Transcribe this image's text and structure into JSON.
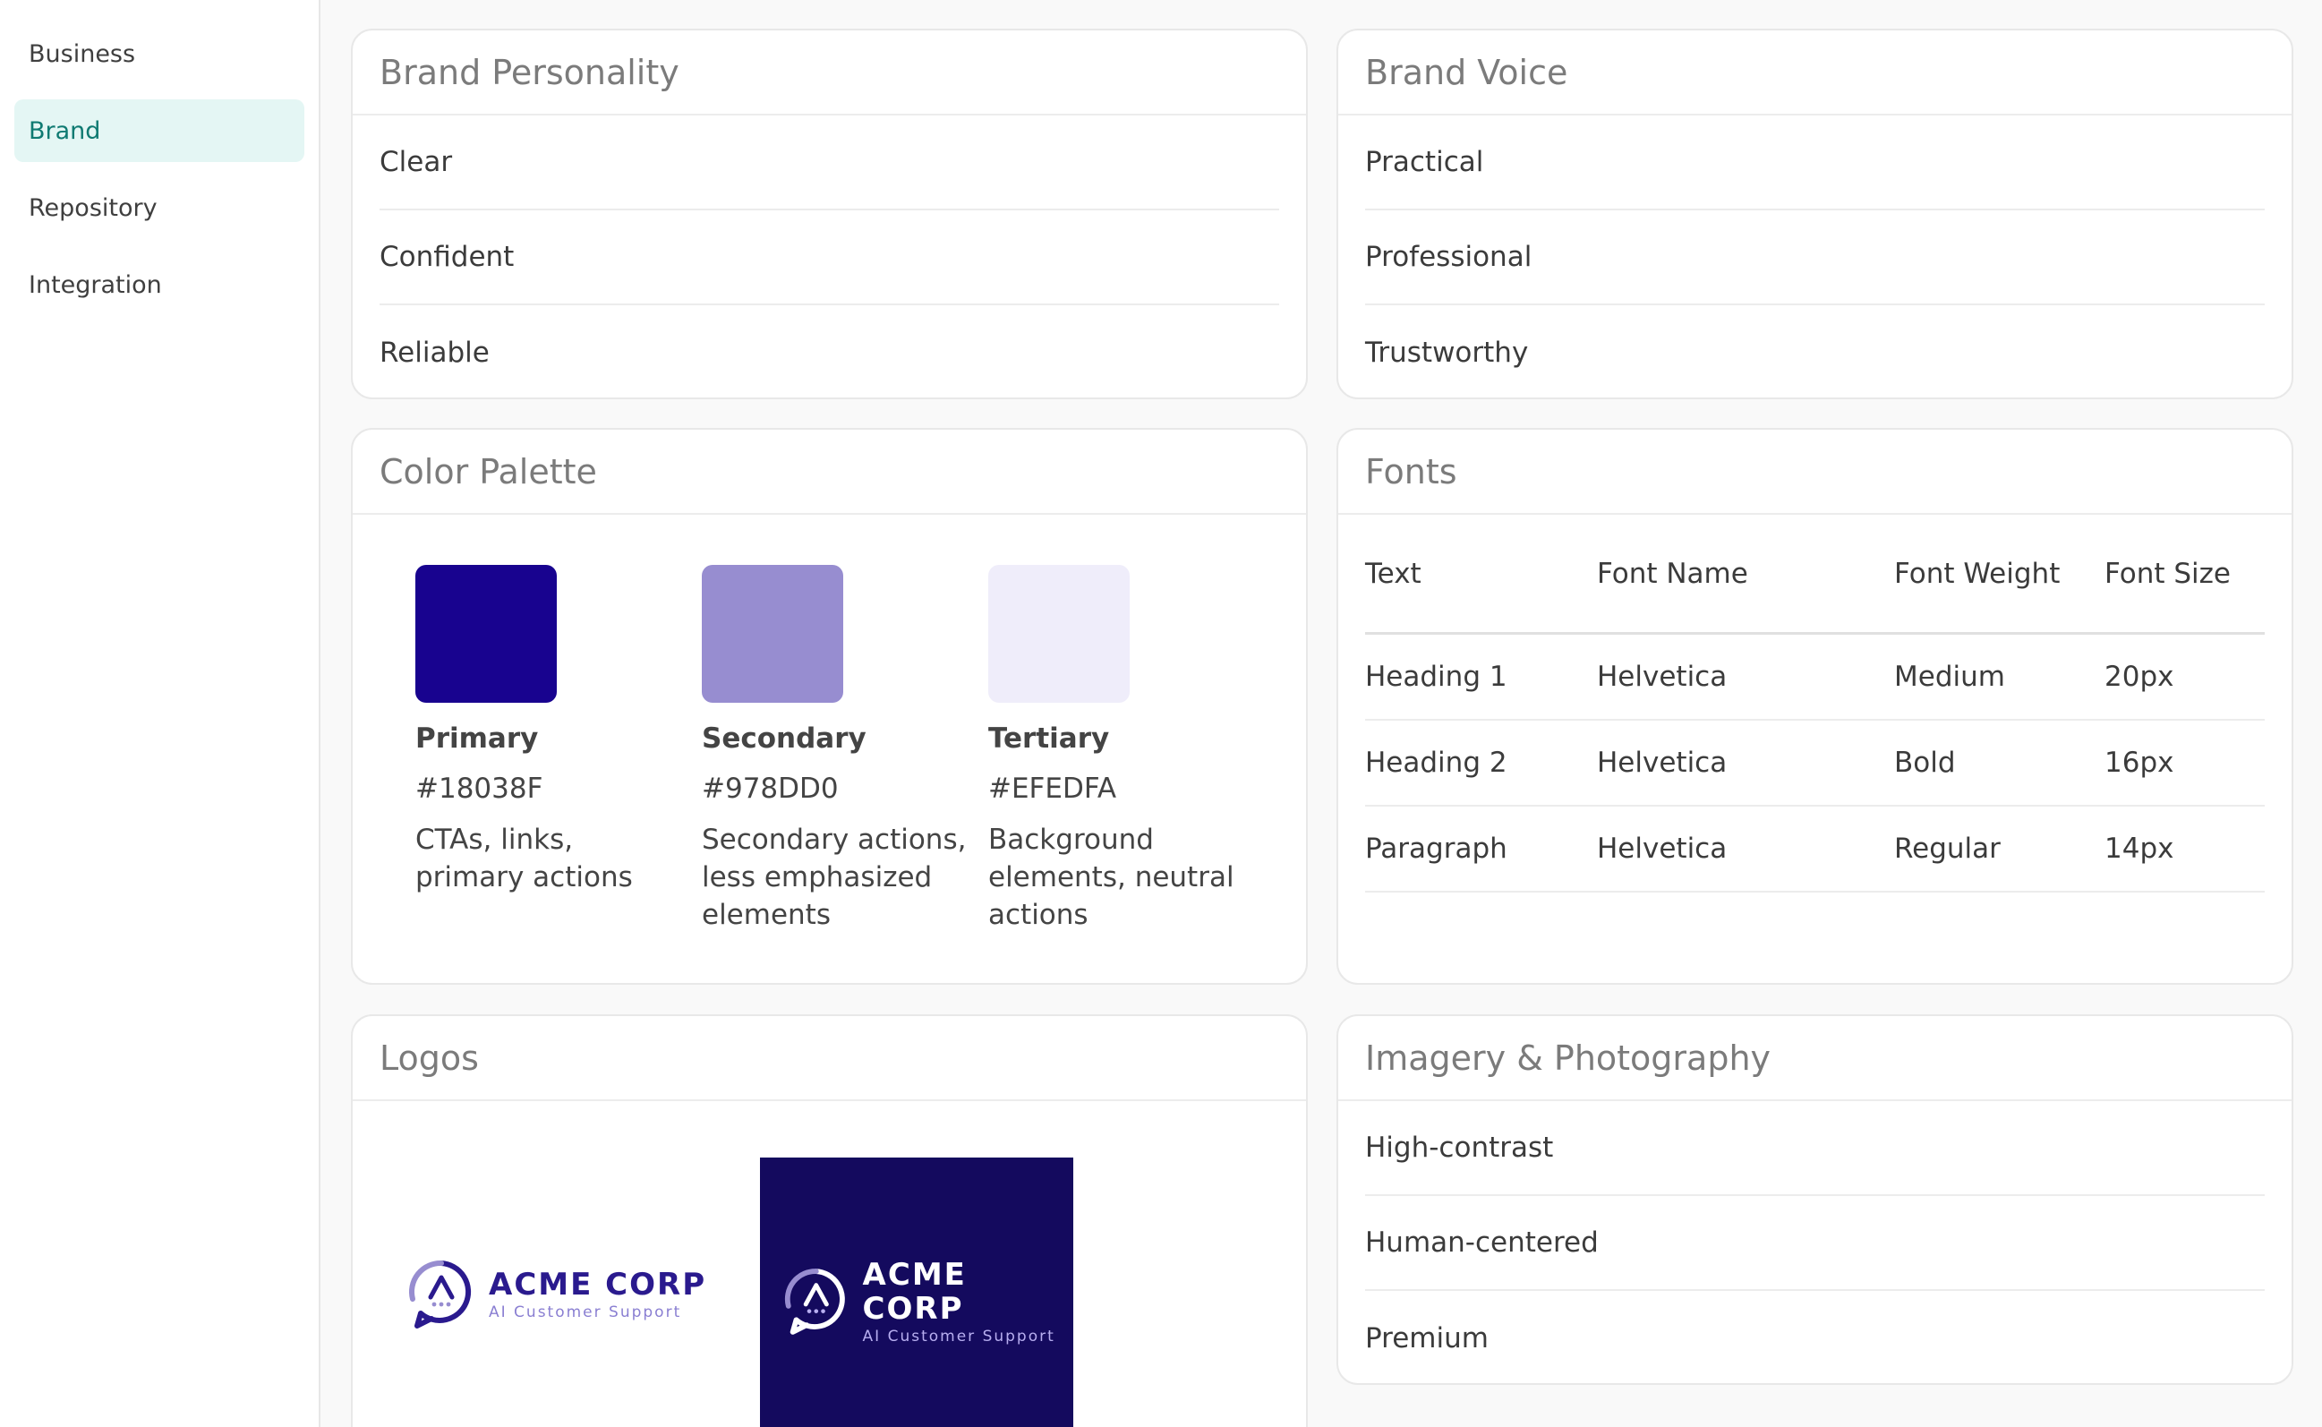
{
  "sidebar": {
    "items": [
      {
        "label": "Business"
      },
      {
        "label": "Brand"
      },
      {
        "label": "Repository"
      },
      {
        "label": "Integration"
      }
    ],
    "active": "Brand"
  },
  "personality": {
    "title": "Brand Personality",
    "items": [
      "Clear",
      "Confident",
      "Reliable"
    ]
  },
  "voice": {
    "title": "Brand Voice",
    "items": [
      "Practical",
      "Professional",
      "Trustworthy"
    ]
  },
  "palette": {
    "title": "Color Palette",
    "colors": [
      {
        "name": "Primary",
        "hex": "#18038F",
        "desc": "CTAs, links, primary actions"
      },
      {
        "name": "Secondary",
        "hex": "#978DD0",
        "desc": "Secondary actions, less emphasized elements"
      },
      {
        "name": "Tertiary",
        "hex": "#EFEDFA",
        "desc": "Background elements, neutral actions"
      }
    ]
  },
  "fonts": {
    "title": "Fonts",
    "headers": [
      "Text",
      "Font Name",
      "Font Weight",
      "Font Size"
    ],
    "rows": [
      [
        "Heading 1",
        "Helvetica",
        "Medium",
        "20px"
      ],
      [
        "Heading 2",
        "Helvetica",
        "Bold",
        "16px"
      ],
      [
        "Paragraph",
        "Helvetica",
        "Regular",
        "14px"
      ]
    ]
  },
  "logos": {
    "title": "Logos",
    "brand_name": "ACME CORP",
    "tagline": "AI Customer Support"
  },
  "imagery": {
    "title": "Imagery & Photography",
    "items": [
      "High-contrast",
      "Human-centered",
      "Premium"
    ]
  },
  "colors": {
    "active_nav_bg": "#e4f6f4",
    "active_nav_text": "#0f7a72",
    "logo_dark_bg": "#140a5e"
  }
}
